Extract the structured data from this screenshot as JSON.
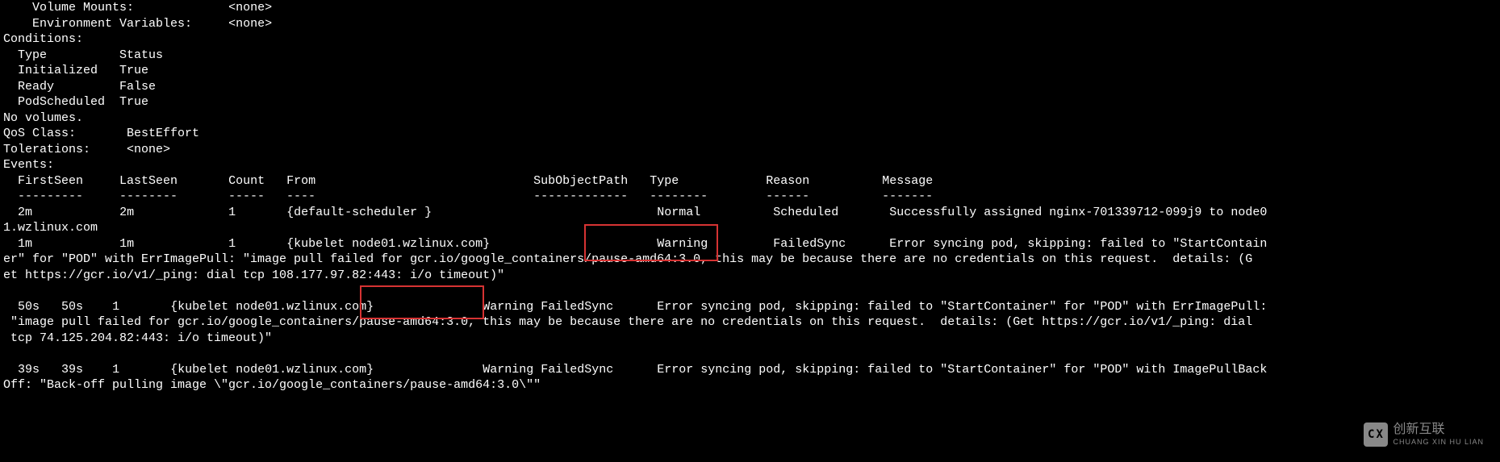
{
  "pod": {
    "volume_mounts_label": "    Volume Mounts:",
    "volume_mounts_value": "<none>",
    "env_vars_label": "    Environment Variables:",
    "env_vars_value": "<none>"
  },
  "conditions": {
    "header": "Conditions:",
    "col_type": "  Type",
    "col_status": "Status",
    "rows": [
      {
        "type": "  Initialized",
        "status": "True"
      },
      {
        "type": "  Ready",
        "status": "False"
      },
      {
        "type": "  PodScheduled",
        "status": "True"
      }
    ]
  },
  "no_volumes": "No volumes.",
  "qos_label": "QoS Class:",
  "qos_value": "BestEffort",
  "tolerations_label": "Tolerations:",
  "tolerations_value": "<none>",
  "events": {
    "header": "Events:",
    "cols": {
      "first_seen": "FirstSeen",
      "last_seen": "LastSeen",
      "count": "Count",
      "from": "From",
      "sub_object_path": "SubObjectPath",
      "type": "Type",
      "reason": "Reason",
      "message": "Message"
    },
    "rows": [
      {
        "first_seen": "2m",
        "last_seen": "2m",
        "count": "1",
        "from": "{default-scheduler }",
        "sub_object_path": "",
        "type": "Normal",
        "reason": "Scheduled",
        "message": "Successfully assigned nginx-701339712-099j9 to node01.wzlinux.com"
      },
      {
        "first_seen": "1m",
        "last_seen": "1m",
        "count": "1",
        "from": "{kubelet node01.wzlinux.com}",
        "sub_object_path": "",
        "type": "Warning",
        "reason": "FailedSync",
        "message": "Error syncing pod, skipping: failed to \"StartContainer\" for \"POD\" with ErrImagePull: \"image pull failed for gcr.io/google_containers/pause-amd64:3.0, this may be because there are no credentials on this request.  details: (Get https://gcr.io/v1/_ping: dial tcp 108.177.97.82:443: i/o timeout)\""
      },
      {
        "first_seen": "50s",
        "last_seen": "50s",
        "count": "1",
        "from": "{kubelet node01.wzlinux.com}",
        "sub_object_path": "",
        "type": "Warning",
        "reason": "FailedSync",
        "message": "Error syncing pod, skipping: failed to \"StartContainer\" for \"POD\" with ErrImagePull: \"image pull failed for gcr.io/google_containers/pause-amd64:3.0, this may be because there are no credentials on this request.  details: (Get https://gcr.io/v1/_ping: dial tcp 74.125.204.82:443: i/o timeout)\""
      },
      {
        "first_seen": "39s",
        "last_seen": "39s",
        "count": "1",
        "from": "{kubelet node01.wzlinux.com}",
        "sub_object_path": "",
        "type": "Warning",
        "reason": "FailedSync",
        "message": "Error syncing pod, skipping: failed to \"StartContainer\" for \"POD\" with ImagePullBackOff: \"Back-off pulling image \\\"gcr.io/google_containers/pause-amd64:3.0\\\"\""
      }
    ]
  },
  "watermark": {
    "logo_text": "CX",
    "cn": "创新互联",
    "en": "CHUANG XIN HU LIAN"
  }
}
